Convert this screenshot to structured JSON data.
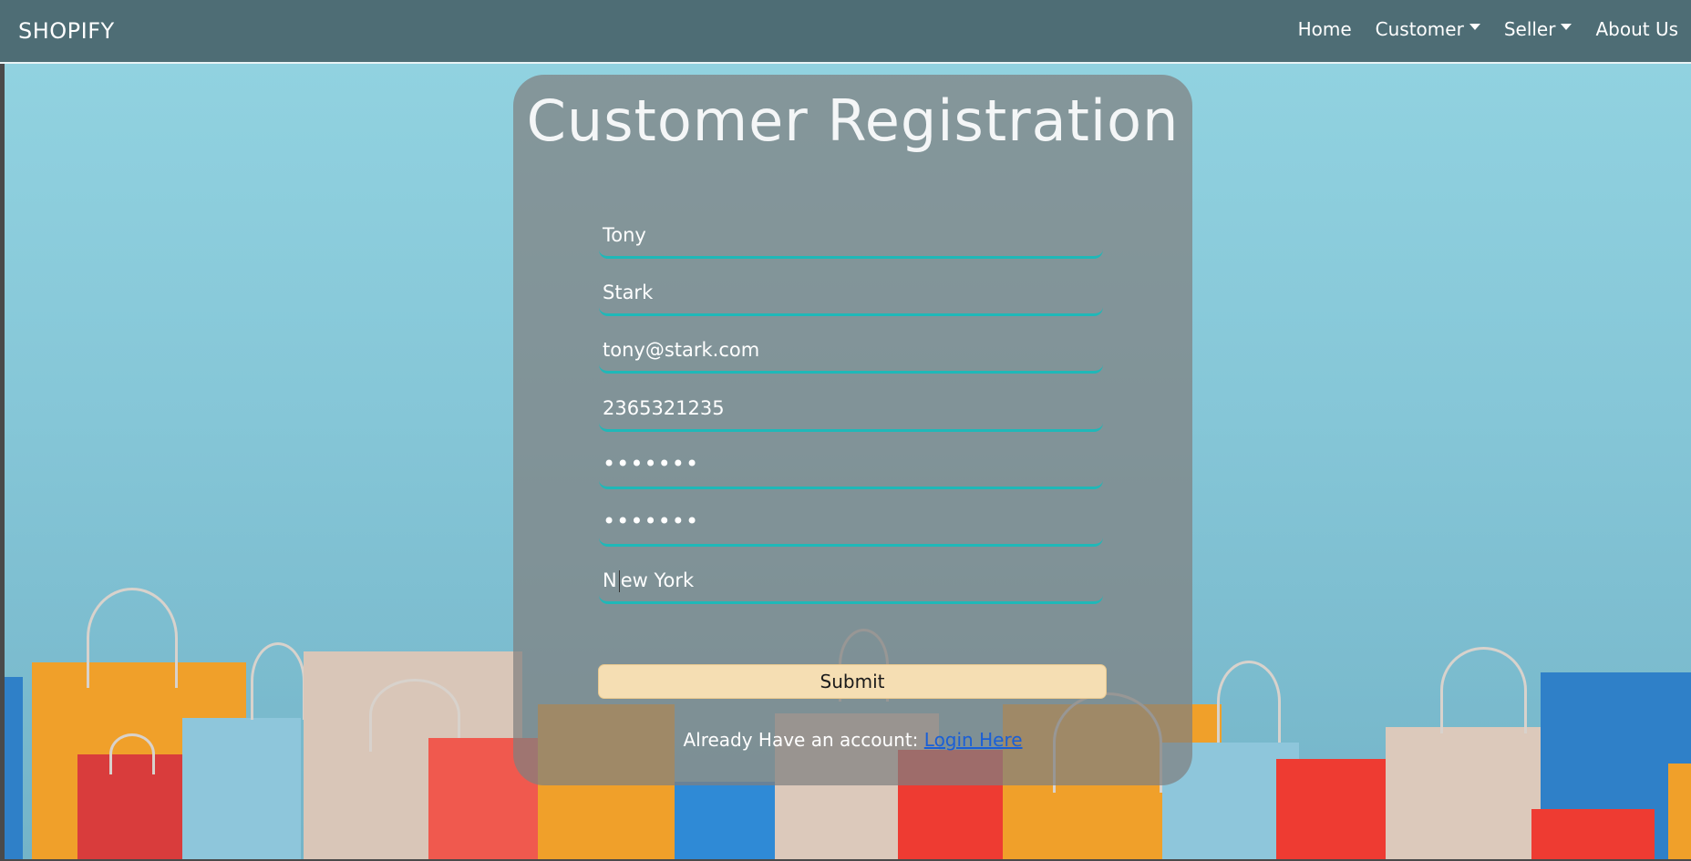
{
  "navbar": {
    "brand": "SHOPIFY",
    "items": [
      {
        "label": "Home",
        "dropdown": false
      },
      {
        "label": "Customer",
        "dropdown": true
      },
      {
        "label": "Seller",
        "dropdown": true
      },
      {
        "label": "About Us",
        "dropdown": false
      }
    ]
  },
  "form": {
    "title": "Customer Registration",
    "fields": {
      "first_name": "Tony",
      "last_name": "Stark",
      "email": "tony@stark.com",
      "phone": "2365321235",
      "password": "•••••••",
      "confirm_password": "•••••••",
      "city_prefix": "N",
      "city_rest": "ew York"
    },
    "submit_label": "Submit",
    "login_prompt": "Already Have an account: ",
    "login_link": "Login Here"
  },
  "colors": {
    "navbar_bg": "#4e6d75",
    "field_underline": "#1fb8b8",
    "submit_bg": "#f5deb3",
    "link": "#1a5fd6"
  }
}
